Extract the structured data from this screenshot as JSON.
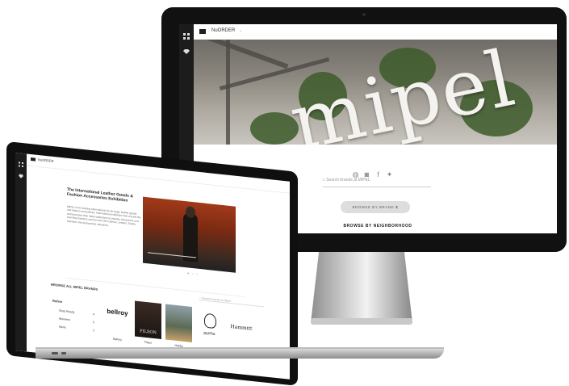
{
  "imac": {
    "app_name": "NuORDER",
    "hero_text": "mipel",
    "search_placeholder": "Search brands at MIPEL",
    "browse_brand_label": "BROWSE BY BRAND",
    "browse_brand_icon": "sliders-icon",
    "browse_neighborhood_label": "BROWSE BY NEIGHBORHOOD",
    "social_icons": [
      "globe-icon",
      "instagram-icon",
      "facebook-icon",
      "twitter-icon"
    ],
    "social_glyphs": [
      "◍",
      "◙",
      "f",
      "✦"
    ]
  },
  "laptop": {
    "app_name": "NuORDER",
    "intro_title": "The International Leather Goods & Fashion Accessories Exhibition",
    "intro_body": "MIPEL is the leading international fair for bags, leather goods and fashion accessories. International exhibitors from around the world present their latest collections to industry influencers and sourcing business owners from the Fashion, Leather, Textile, footwear and accessories industries.",
    "carousel_dots": 3,
    "browse_all_label": "BROWSE ALL MIPEL BRANDS",
    "search_placeholder": "Search brands at Mipel",
    "filters": {
      "heading": "Refine",
      "items": [
        {
          "label": "Shop Ready",
          "count": "4"
        },
        {
          "label": "Womens",
          "count": "5"
        },
        {
          "label": "Mens",
          "count": "2"
        }
      ]
    },
    "brands": [
      {
        "logo_text": "bellroy",
        "name": "Bellroy"
      },
      {
        "logo_text": "FILSON",
        "name": "Filson"
      },
      {
        "logo_text": "",
        "name": "Hobbs"
      },
      {
        "logo_text": "pyrrho",
        "name": "Pyrrho"
      },
      {
        "logo_text": "Hammitt",
        "name": "Hammitt"
      }
    ]
  },
  "colors": {
    "sidebar": "#1c1c1c",
    "bezel": "#111111",
    "pill": "#dddddd"
  }
}
